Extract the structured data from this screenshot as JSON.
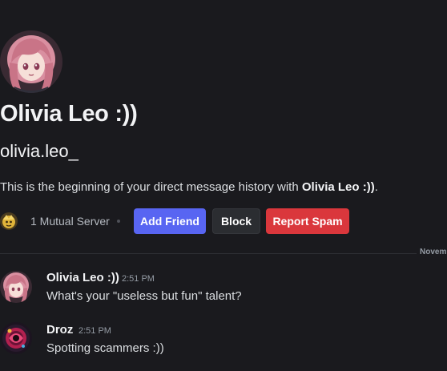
{
  "profile": {
    "display_name": "Olivia Leo :))",
    "username": "olivia.leo_",
    "intro_prefix": "This is the beginning of your direct message history with ",
    "intro_name": "Olivia Leo :))",
    "intro_suffix": ".",
    "avatar_icon": "anime-girl-avatar"
  },
  "mutual": {
    "server_icon": "server-icon",
    "label": "1 Mutual Server"
  },
  "actions": {
    "add_friend": "Add Friend",
    "block": "Block",
    "report_spam": "Report Spam"
  },
  "divider": {
    "date_label": "Novem"
  },
  "messages": [
    {
      "author": "Olivia Leo :))",
      "time": "2:51 PM",
      "text": "What's your \"useless but fun\" talent?",
      "avatar_icon": "anime-girl-avatar"
    },
    {
      "author": "Droz",
      "time": "2:51 PM",
      "text": "Spotting scammers :))",
      "avatar_icon": "droz-avatar"
    }
  ],
  "colors": {
    "background": "#1a1a1e",
    "blurple": "#5865f2",
    "danger": "#da373c",
    "secondary": "#2b2d31"
  }
}
